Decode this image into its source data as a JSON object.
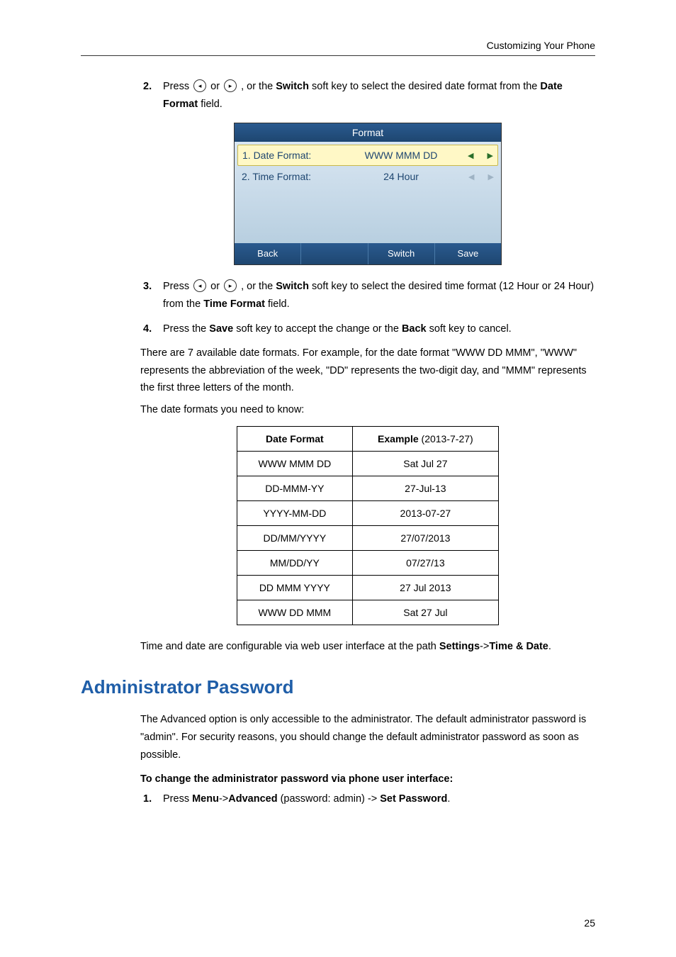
{
  "header": {
    "title": "Customizing Your Phone"
  },
  "step2": {
    "num": "2.",
    "text_a": "Press ",
    "text_or": " or ",
    "text_b": " , or the ",
    "switch": "Switch",
    "text_c": " soft key to select the desired date format from the ",
    "date_format": "Date Format",
    "text_d": " field."
  },
  "phone": {
    "title": "Format",
    "row1_label": "1. Date Format:",
    "row1_value": "WWW MMM DD",
    "row2_label": "2. Time Format:",
    "row2_value": "24 Hour",
    "sk_back": "Back",
    "sk_switch": "Switch",
    "sk_save": "Save"
  },
  "step3": {
    "num": "3.",
    "text_a": "Press ",
    "text_or": " or ",
    "text_b": " , or the ",
    "switch": "Switch",
    "text_c": " soft key to select the desired time format (12 Hour or 24 Hour) from the ",
    "time_format": "Time Format",
    "text_d": " field."
  },
  "step4": {
    "num": "4.",
    "text_a": "Press the ",
    "save": "Save",
    "text_b": " soft key to accept the change or the ",
    "back": "Back",
    "text_c": " soft key to cancel."
  },
  "para_formats": "There are 7 available date formats. For example, for the date format \"WWW DD MMM\", \"WWW\" represents the abbreviation of the week, \"DD\" represents the two-digit day, and \"MMM\" represents the first three letters of the month.",
  "para_need": "The date formats you need to know:",
  "table": {
    "h1": "Date Format",
    "h2_a": "Example",
    "h2_b": " (2013-7-27)",
    "rows": [
      {
        "fmt": "WWW MMM DD",
        "ex": "Sat Jul 27"
      },
      {
        "fmt": "DD-MMM-YY",
        "ex": "27-Jul-13"
      },
      {
        "fmt": "YYYY-MM-DD",
        "ex": "2013-07-27"
      },
      {
        "fmt": "DD/MM/YYYY",
        "ex": "27/07/2013"
      },
      {
        "fmt": "MM/DD/YY",
        "ex": "07/27/13"
      },
      {
        "fmt": "DD MMM YYYY",
        "ex": "27 Jul 2013"
      },
      {
        "fmt": "WWW DD MMM",
        "ex": "Sat 27 Jul"
      }
    ]
  },
  "para_web_a": "Time and date are configurable via web user interface at the path ",
  "para_web_b": "Settings",
  "para_web_c": "->",
  "para_web_d": "Time & Date",
  "para_web_e": ".",
  "section_title": "Administrator Password",
  "admin_para": "The Advanced option is only accessible to the administrator. The default administrator password is \"admin\". For security reasons, you should change the default administrator password as soon as possible.",
  "admin_sub": "To change the administrator password via phone user interface:",
  "admin_step1": {
    "num": "1.",
    "a": "Press ",
    "menu": "Menu",
    "arr1": "->",
    "advanced": "Advanced",
    "b": " (password: admin) ->",
    "setpw": "Set Password",
    "c": "."
  },
  "page_number": "25",
  "icons": {
    "left": "◂",
    "right": "▸",
    "tri_l": "◀",
    "tri_r": "▶"
  }
}
